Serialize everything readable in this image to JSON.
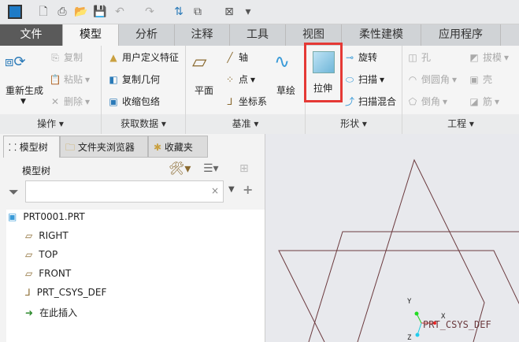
{
  "tabs": [
    "文件",
    "模型",
    "分析",
    "注释",
    "工具",
    "视图",
    "柔性建模",
    "应用程序"
  ],
  "ops": {
    "regen": "重新生成",
    "copy": "复制",
    "paste": "粘贴",
    "delete": "删除",
    "group": "操作"
  },
  "getdata": {
    "udf": "用户定义特征",
    "copygeom": "复制几何",
    "shrinkwrap": "收缩包络",
    "group": "获取数据"
  },
  "datum": {
    "plane": "平面",
    "axis": "轴",
    "point": "点",
    "csys": "坐标系",
    "sketch": "草绘",
    "group": "基准"
  },
  "shape": {
    "extrude": "拉伸",
    "revolve": "旋转",
    "sweep": "扫描",
    "swept_blend": "扫描混合",
    "group": "形状"
  },
  "eng": {
    "hole": "孔",
    "round": "倒圆角",
    "chamfer": "倒角",
    "draft": "拔模",
    "shell": "壳",
    "rib": "筋",
    "group": "工程"
  },
  "panel": {
    "tabs": [
      "模型树",
      "文件夹浏览器",
      "收藏夹"
    ],
    "title": "模型树",
    "search_placeholder": ""
  },
  "tree": [
    "PRT0001.PRT",
    "RIGHT",
    "TOP",
    "FRONT",
    "PRT_CSYS_DEF",
    "在此插入"
  ],
  "graphics": {
    "csys_label": "PRT_CSYS_DEF",
    "x": "X",
    "y": "Y",
    "z": "Z"
  },
  "colors": {
    "highlight": "#e53935",
    "datum": "#6b3a3e"
  }
}
